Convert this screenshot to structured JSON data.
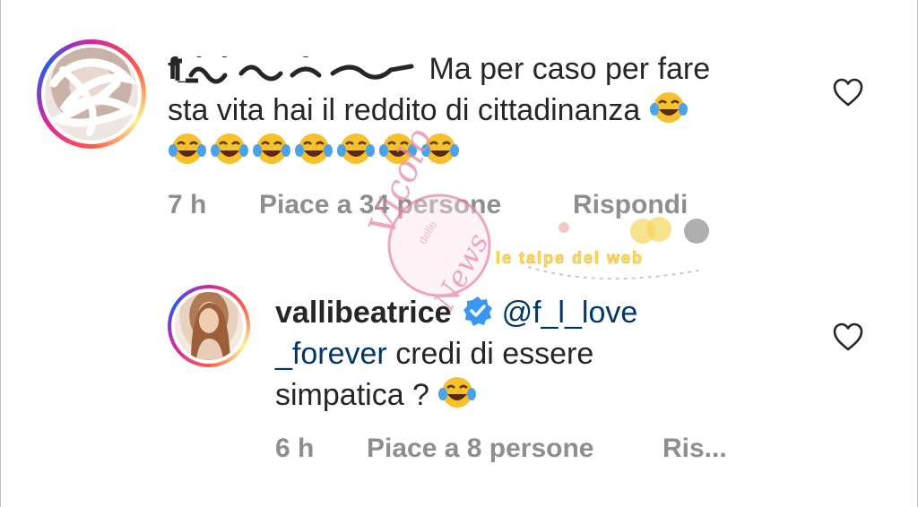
{
  "comments": [
    {
      "username": "f_l_love_forever",
      "lines": [
        "Ma per caso per fare",
        "sta vita hai il reddito di cittadinanza"
      ],
      "emoji_icon": "face-with-tears-of-joy-icon",
      "time": "7 h",
      "likes": "Piace a 34 persone",
      "reply": "Rispondi"
    },
    {
      "username": "vallibeatrice",
      "verified_icon": "verified-badge-icon",
      "mention_part1": "@f_l_love",
      "mention_part2": "_forever",
      "line1_rest": "credi di essere",
      "line3": "simpatica ?",
      "emoji_icon": "face-with-tears-of-joy-icon",
      "time": "6 h",
      "likes": "Piace a 8 persone",
      "reply": "Ris..."
    }
  ],
  "watermarks": {
    "primary_lines": [
      "Vicolo",
      "delle",
      "News"
    ],
    "secondary": "le talpe del web"
  },
  "colors": {
    "text": "#262626",
    "meta": "#8e8e8e",
    "mention": "#00376b",
    "verified": "#3897f0",
    "watermark_pink": "#e88aa8",
    "watermark_yellow": "#f6d55c"
  }
}
